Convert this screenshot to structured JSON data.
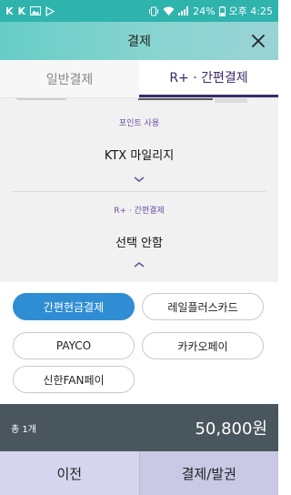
{
  "status_bar": {
    "notif_icons": [
      "K",
      "K"
    ],
    "battery": "24%",
    "time": "오후 4:25"
  },
  "header": {
    "title": "결제",
    "close_icon": "close-icon"
  },
  "tabs": [
    {
      "label": "일반결제",
      "selected": false
    },
    {
      "label": "R+ · 간편결제",
      "selected": true
    }
  ],
  "point_section": {
    "label": "포인트 사용",
    "value": "KTX 마일리지"
  },
  "rplus_section": {
    "label": "R+ · 간편결제",
    "value": "선택 안함"
  },
  "payment_methods": [
    {
      "label": "간편현금결제",
      "selected": true
    },
    {
      "label": "레일플러스카드",
      "selected": false
    },
    {
      "label": "PAYCO",
      "selected": false
    },
    {
      "label": "카카오페이",
      "selected": false
    },
    {
      "label": "신한FAN페이",
      "selected": false
    }
  ],
  "total": {
    "count": "총 1개",
    "amount": "50,800원"
  },
  "buttons": {
    "prev": "이전",
    "pay": "결제/발권"
  },
  "colors": {
    "accent_teal": "#2fb3ad",
    "selected_blue": "#2f8ed3",
    "tab_purple": "#3a2a6b",
    "total_bar": "#4a565e"
  }
}
